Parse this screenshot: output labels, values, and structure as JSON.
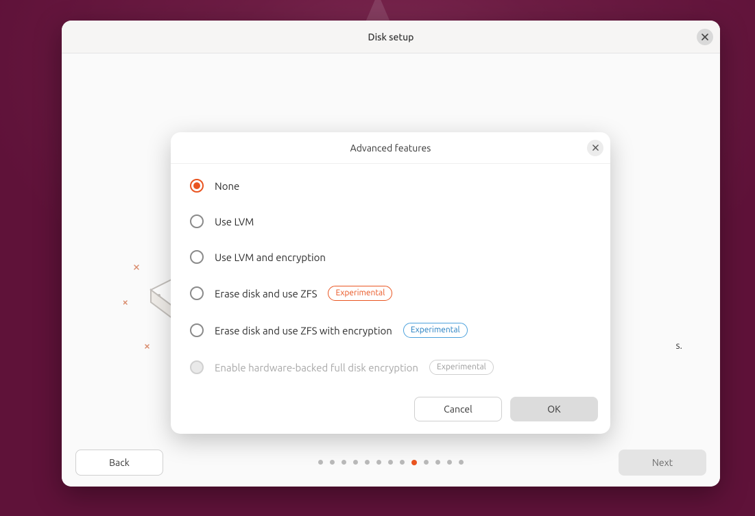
{
  "window": {
    "title": "Disk setup",
    "partial_text_right": "s."
  },
  "footer": {
    "back_label": "Back",
    "next_label": "Next",
    "total_dots": 13,
    "active_dot_index": 8
  },
  "dialog": {
    "title": "Advanced features",
    "badge_experimental": "Experimental",
    "options": [
      {
        "label": "None",
        "selected": true,
        "disabled": false,
        "badge": null
      },
      {
        "label": "Use LVM",
        "selected": false,
        "disabled": false,
        "badge": null
      },
      {
        "label": "Use LVM and encryption",
        "selected": false,
        "disabled": false,
        "badge": null
      },
      {
        "label": "Erase disk and use ZFS",
        "selected": false,
        "disabled": false,
        "badge": "orange"
      },
      {
        "label": "Erase disk and use ZFS with encryption",
        "selected": false,
        "disabled": false,
        "badge": "blue"
      },
      {
        "label": "Enable hardware-backed full disk encryption",
        "selected": false,
        "disabled": true,
        "badge": "disabled"
      }
    ],
    "cancel_label": "Cancel",
    "ok_label": "OK"
  }
}
